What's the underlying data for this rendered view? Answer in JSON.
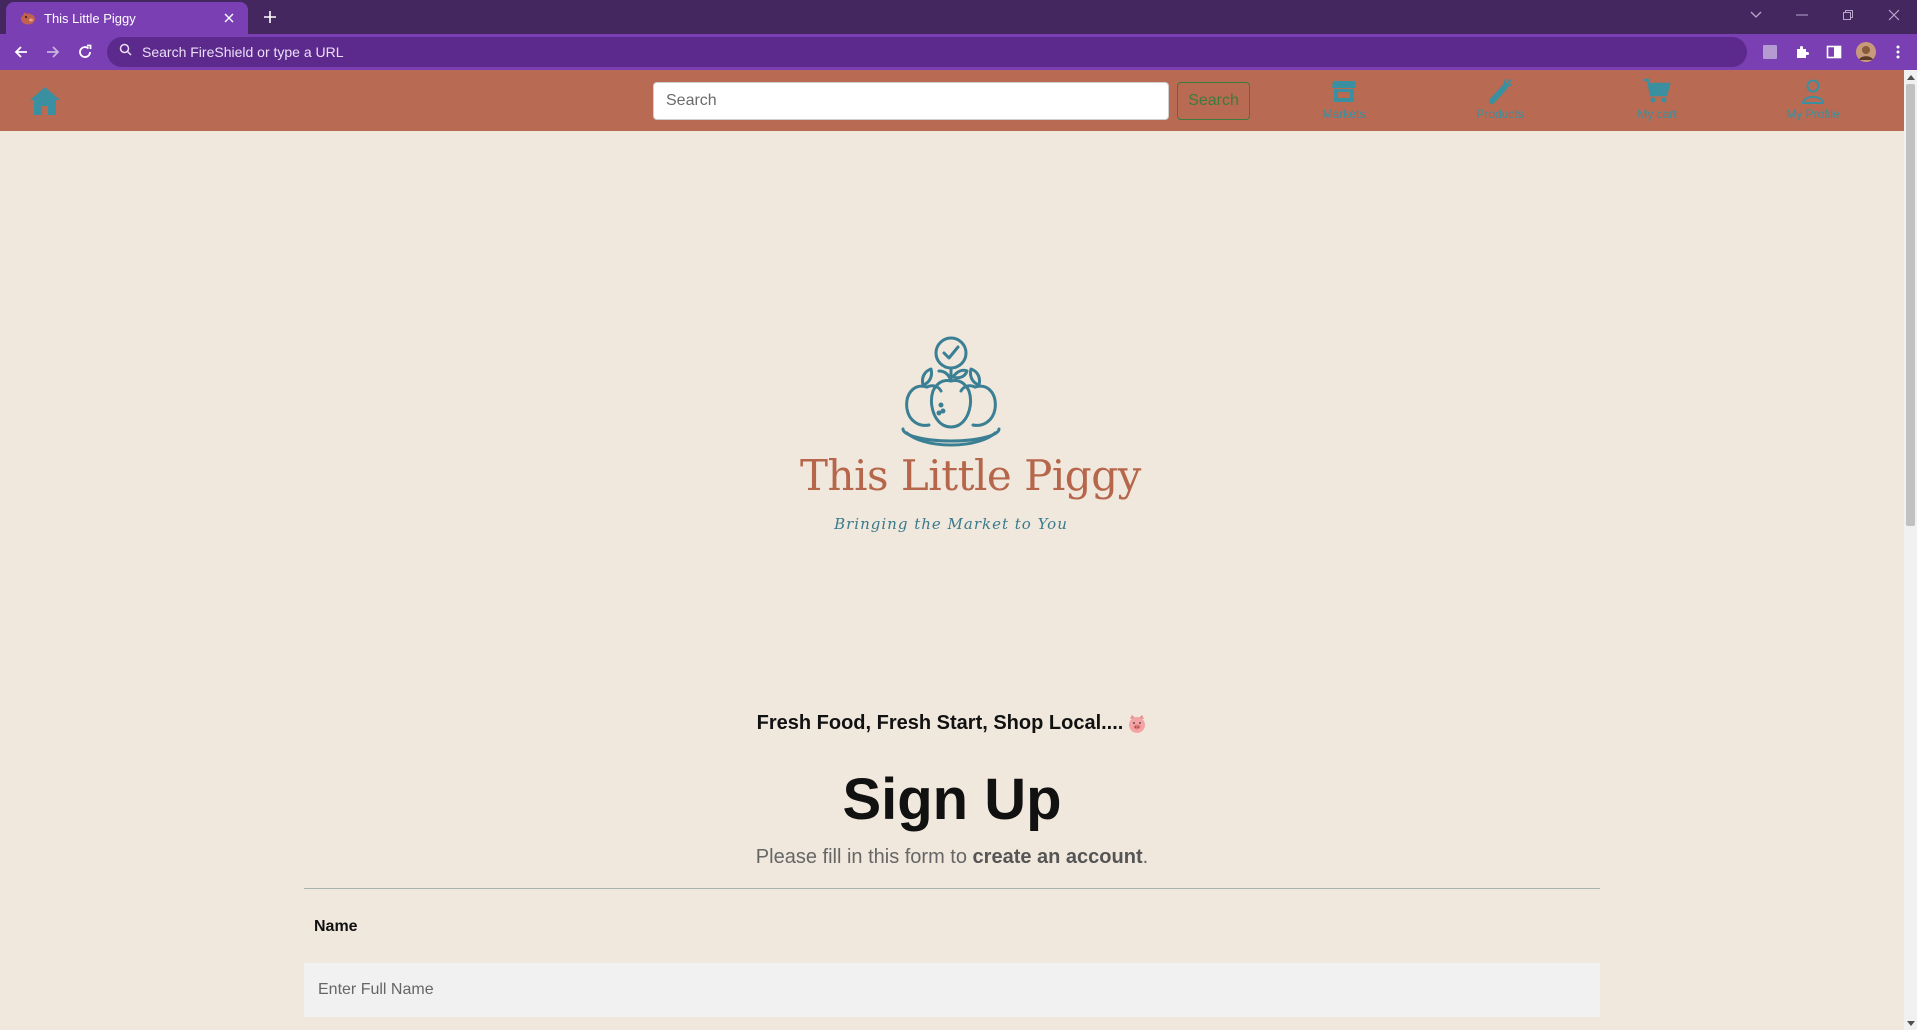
{
  "browser": {
    "tab_title": "This Little Piggy",
    "omnibox_placeholder": "Search FireShield or type a URL"
  },
  "nav": {
    "search_placeholder": "Search",
    "search_button": "Search",
    "items": [
      {
        "label": "Markets",
        "icon": "store-icon"
      },
      {
        "label": "Products",
        "icon": "carrot-icon"
      },
      {
        "label": "My cart",
        "icon": "cart-icon"
      },
      {
        "label": "My Profile",
        "icon": "user-icon"
      }
    ]
  },
  "brand": {
    "name": "This Little Piggy",
    "tagline": "Bringing the Market to You"
  },
  "page": {
    "slogan": "Fresh Food, Fresh Start, Shop Local....",
    "heading": "Sign Up",
    "subtext_prefix": "Please fill in this form to ",
    "subtext_bold": "create an account",
    "subtext_suffix": "."
  },
  "form": {
    "name_label": "Name",
    "name_placeholder": "Enter Full Name"
  },
  "colors": {
    "chrome_dark": "#44275f",
    "chrome_accent": "#7a3fb3",
    "nav_bg": "#b96a52",
    "page_bg": "#f0e8dd",
    "brand_rust": "#b6664a",
    "brand_teal": "#3a8fa0"
  }
}
